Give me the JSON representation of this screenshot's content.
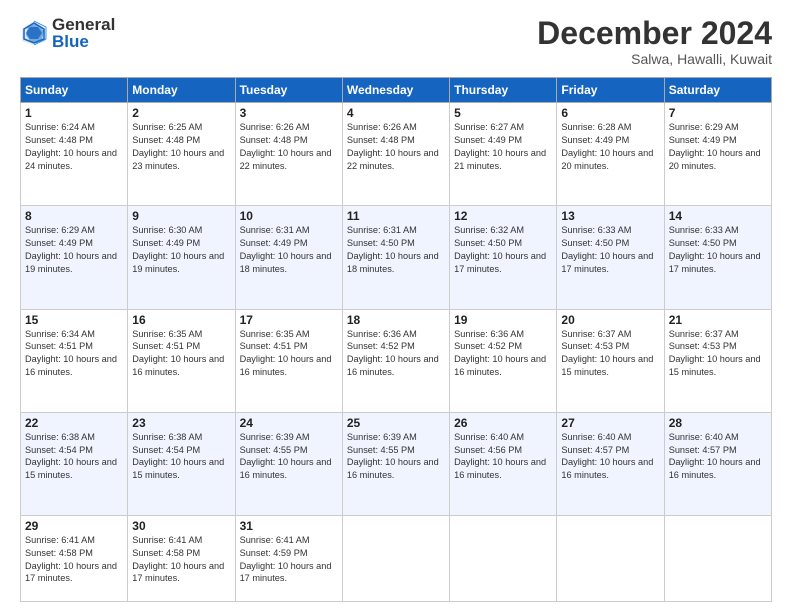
{
  "logo": {
    "general": "General",
    "blue": "Blue"
  },
  "header": {
    "month": "December 2024",
    "location": "Salwa, Hawalli, Kuwait"
  },
  "weekdays": [
    "Sunday",
    "Monday",
    "Tuesday",
    "Wednesday",
    "Thursday",
    "Friday",
    "Saturday"
  ],
  "weeks": [
    [
      {
        "day": "1",
        "sunrise": "6:24 AM",
        "sunset": "4:48 PM",
        "daylight": "10 hours and 24 minutes."
      },
      {
        "day": "2",
        "sunrise": "6:25 AM",
        "sunset": "4:48 PM",
        "daylight": "10 hours and 23 minutes."
      },
      {
        "day": "3",
        "sunrise": "6:26 AM",
        "sunset": "4:48 PM",
        "daylight": "10 hours and 22 minutes."
      },
      {
        "day": "4",
        "sunrise": "6:26 AM",
        "sunset": "4:48 PM",
        "daylight": "10 hours and 22 minutes."
      },
      {
        "day": "5",
        "sunrise": "6:27 AM",
        "sunset": "4:49 PM",
        "daylight": "10 hours and 21 minutes."
      },
      {
        "day": "6",
        "sunrise": "6:28 AM",
        "sunset": "4:49 PM",
        "daylight": "10 hours and 20 minutes."
      },
      {
        "day": "7",
        "sunrise": "6:29 AM",
        "sunset": "4:49 PM",
        "daylight": "10 hours and 20 minutes."
      }
    ],
    [
      {
        "day": "8",
        "sunrise": "6:29 AM",
        "sunset": "4:49 PM",
        "daylight": "10 hours and 19 minutes."
      },
      {
        "day": "9",
        "sunrise": "6:30 AM",
        "sunset": "4:49 PM",
        "daylight": "10 hours and 19 minutes."
      },
      {
        "day": "10",
        "sunrise": "6:31 AM",
        "sunset": "4:49 PM",
        "daylight": "10 hours and 18 minutes."
      },
      {
        "day": "11",
        "sunrise": "6:31 AM",
        "sunset": "4:50 PM",
        "daylight": "10 hours and 18 minutes."
      },
      {
        "day": "12",
        "sunrise": "6:32 AM",
        "sunset": "4:50 PM",
        "daylight": "10 hours and 17 minutes."
      },
      {
        "day": "13",
        "sunrise": "6:33 AM",
        "sunset": "4:50 PM",
        "daylight": "10 hours and 17 minutes."
      },
      {
        "day": "14",
        "sunrise": "6:33 AM",
        "sunset": "4:50 PM",
        "daylight": "10 hours and 17 minutes."
      }
    ],
    [
      {
        "day": "15",
        "sunrise": "6:34 AM",
        "sunset": "4:51 PM",
        "daylight": "10 hours and 16 minutes."
      },
      {
        "day": "16",
        "sunrise": "6:35 AM",
        "sunset": "4:51 PM",
        "daylight": "10 hours and 16 minutes."
      },
      {
        "day": "17",
        "sunrise": "6:35 AM",
        "sunset": "4:51 PM",
        "daylight": "10 hours and 16 minutes."
      },
      {
        "day": "18",
        "sunrise": "6:36 AM",
        "sunset": "4:52 PM",
        "daylight": "10 hours and 16 minutes."
      },
      {
        "day": "19",
        "sunrise": "6:36 AM",
        "sunset": "4:52 PM",
        "daylight": "10 hours and 16 minutes."
      },
      {
        "day": "20",
        "sunrise": "6:37 AM",
        "sunset": "4:53 PM",
        "daylight": "10 hours and 15 minutes."
      },
      {
        "day": "21",
        "sunrise": "6:37 AM",
        "sunset": "4:53 PM",
        "daylight": "10 hours and 15 minutes."
      }
    ],
    [
      {
        "day": "22",
        "sunrise": "6:38 AM",
        "sunset": "4:54 PM",
        "daylight": "10 hours and 15 minutes."
      },
      {
        "day": "23",
        "sunrise": "6:38 AM",
        "sunset": "4:54 PM",
        "daylight": "10 hours and 15 minutes."
      },
      {
        "day": "24",
        "sunrise": "6:39 AM",
        "sunset": "4:55 PM",
        "daylight": "10 hours and 16 minutes."
      },
      {
        "day": "25",
        "sunrise": "6:39 AM",
        "sunset": "4:55 PM",
        "daylight": "10 hours and 16 minutes."
      },
      {
        "day": "26",
        "sunrise": "6:40 AM",
        "sunset": "4:56 PM",
        "daylight": "10 hours and 16 minutes."
      },
      {
        "day": "27",
        "sunrise": "6:40 AM",
        "sunset": "4:57 PM",
        "daylight": "10 hours and 16 minutes."
      },
      {
        "day": "28",
        "sunrise": "6:40 AM",
        "sunset": "4:57 PM",
        "daylight": "10 hours and 16 minutes."
      }
    ],
    [
      {
        "day": "29",
        "sunrise": "6:41 AM",
        "sunset": "4:58 PM",
        "daylight": "10 hours and 17 minutes."
      },
      {
        "day": "30",
        "sunrise": "6:41 AM",
        "sunset": "4:58 PM",
        "daylight": "10 hours and 17 minutes."
      },
      {
        "day": "31",
        "sunrise": "6:41 AM",
        "sunset": "4:59 PM",
        "daylight": "10 hours and 17 minutes."
      },
      null,
      null,
      null,
      null
    ]
  ]
}
